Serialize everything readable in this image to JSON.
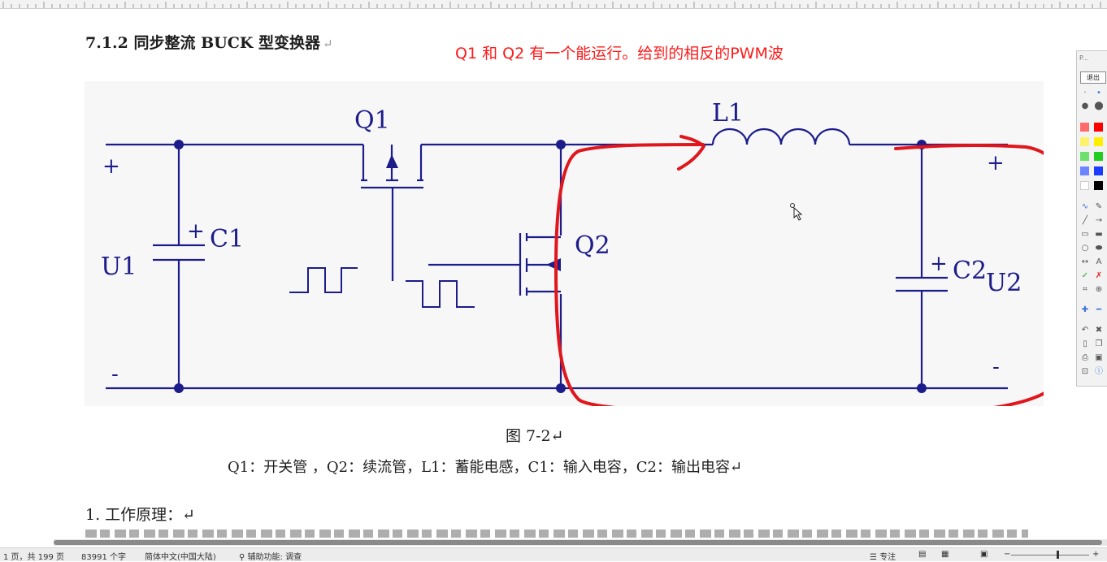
{
  "document": {
    "heading": "7.1.2 同步整流 BUCK 型变换器",
    "return_mark": "↵",
    "annotation": "Q1 和 Q2 有一个能运行。给到的相反的PWM波",
    "figure_caption": "图 7-2↵",
    "legend": "Q1：开关管 ，Q2：续流管，L1：蓄能电感，C1：输入电容，C2：输出电容↵",
    "section_title": "1. 工作原理：↵"
  },
  "circuit": {
    "labels": {
      "q1": "Q1",
      "q2": "Q2",
      "l1": "L1",
      "c1": "C1",
      "c2": "C2",
      "u1": "U1",
      "u2": "U2",
      "plus_in": "+",
      "minus_in": "-",
      "plus_out": "+",
      "minus_out": "-",
      "c1_plus": "+",
      "c2_plus": "+"
    },
    "wire_color": "#1c1c8a",
    "annotation_color": "#ff1a1a"
  },
  "status": {
    "page_info": "1 页，共 199 页",
    "word_count": "83991 个字",
    "language": "简体中文(中国大陆)",
    "accessibility": "辅助功能: 调查",
    "focus": "专注"
  },
  "palette": {
    "title": "P...",
    "exit_label": "退出",
    "colors": [
      "#ff0000",
      "#ffee00",
      "#22cc22",
      "#1a3cff",
      "#000000",
      "#ffffff"
    ]
  }
}
